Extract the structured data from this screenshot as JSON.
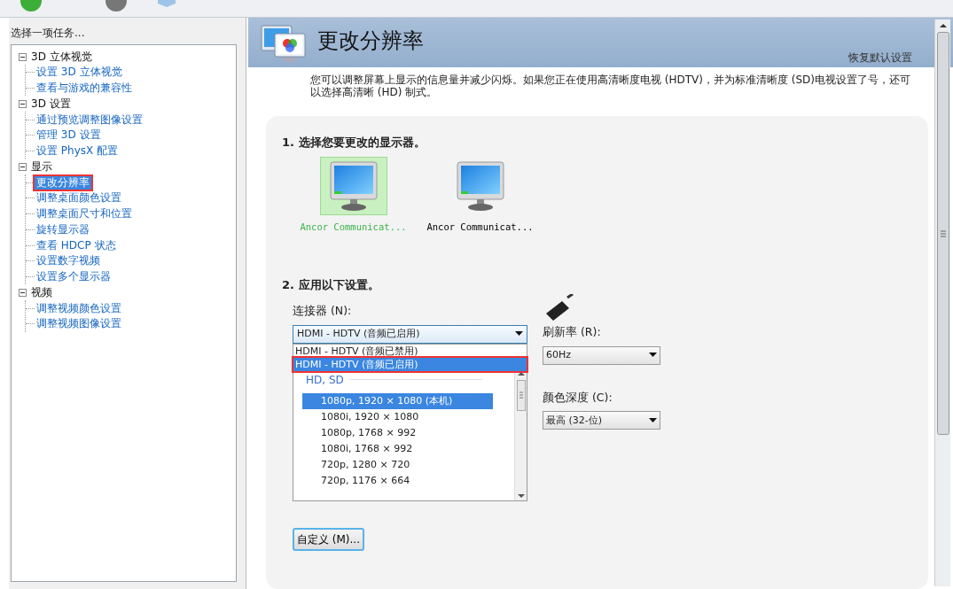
{
  "sidebar": {
    "title": "选择一项任务...",
    "tree": [
      {
        "label": "3D 立体视觉",
        "expanded": true,
        "selected": false,
        "children": [
          {
            "label": "设置 3D 立体视觉",
            "selected": false
          },
          {
            "label": "查看与游戏的兼容性",
            "selected": false
          }
        ]
      },
      {
        "label": "3D 设置",
        "expanded": true,
        "selected": false,
        "children": [
          {
            "label": "通过预览调整图像设置",
            "selected": false
          },
          {
            "label": "管理 3D 设置",
            "selected": false
          },
          {
            "label": "设置 PhysX 配置",
            "selected": false
          }
        ]
      },
      {
        "label": "显示",
        "expanded": true,
        "selected": false,
        "children": [
          {
            "label": "更改分辨率",
            "selected": true
          },
          {
            "label": "调整桌面颜色设置",
            "selected": false
          },
          {
            "label": "调整桌面尺寸和位置",
            "selected": false
          },
          {
            "label": "旋转显示器",
            "selected": false
          },
          {
            "label": "查看 HDCP 状态",
            "selected": false
          },
          {
            "label": "设置数字视频",
            "selected": false
          },
          {
            "label": "设置多个显示器",
            "selected": false
          }
        ]
      },
      {
        "label": "视频",
        "expanded": true,
        "selected": false,
        "children": [
          {
            "label": "调整视频颜色设置",
            "selected": false
          },
          {
            "label": "调整视频图像设置",
            "selected": false
          }
        ]
      }
    ]
  },
  "header": {
    "title": "更改分辨率",
    "restore_link": "恢复默认设置"
  },
  "description": "您可以调整屏幕上显示的信息量并减少闪烁。如果您正在使用高清晰度电视 (HDTV)，并为标准清晰度 (SD)电视设置了号，还可以选择高清晰 (HD) 制式。",
  "section1": {
    "heading": "1. 选择您要更改的显示器。",
    "displays": [
      {
        "label": "Ancor Communicat...",
        "selected": true
      },
      {
        "label": "Ancor Communicat...",
        "selected": false
      }
    ]
  },
  "section2": {
    "heading": "2. 应用以下设置。",
    "connector": {
      "label": "连接器 (N):",
      "value": "HDMI - HDTV (音频已启用)",
      "expanded": true,
      "options": [
        {
          "label": "HDMI - HDTV (音频已禁用)",
          "selected": false
        },
        {
          "label": "HDMI - HDTV (音频已启用)",
          "selected": true
        }
      ]
    },
    "resolutions": {
      "group": "HD, SD",
      "items": [
        {
          "label": "1080p, 1920 × 1080 (本机)",
          "selected": true
        },
        {
          "label": "1080i, 1920 × 1080",
          "selected": false
        },
        {
          "label": "1080p, 1768 × 992",
          "selected": false
        },
        {
          "label": "1080i, 1768 × 992",
          "selected": false
        },
        {
          "label": "720p, 1280 × 720",
          "selected": false
        },
        {
          "label": "720p, 1176 × 664",
          "selected": false
        }
      ]
    },
    "refresh_rate": {
      "label": "刷新率 (R):",
      "value": "60Hz"
    },
    "color_depth": {
      "label": "颜色深度 (C):",
      "value": "最高 (32-位)"
    },
    "customize_button": "自定义 (M)..."
  }
}
